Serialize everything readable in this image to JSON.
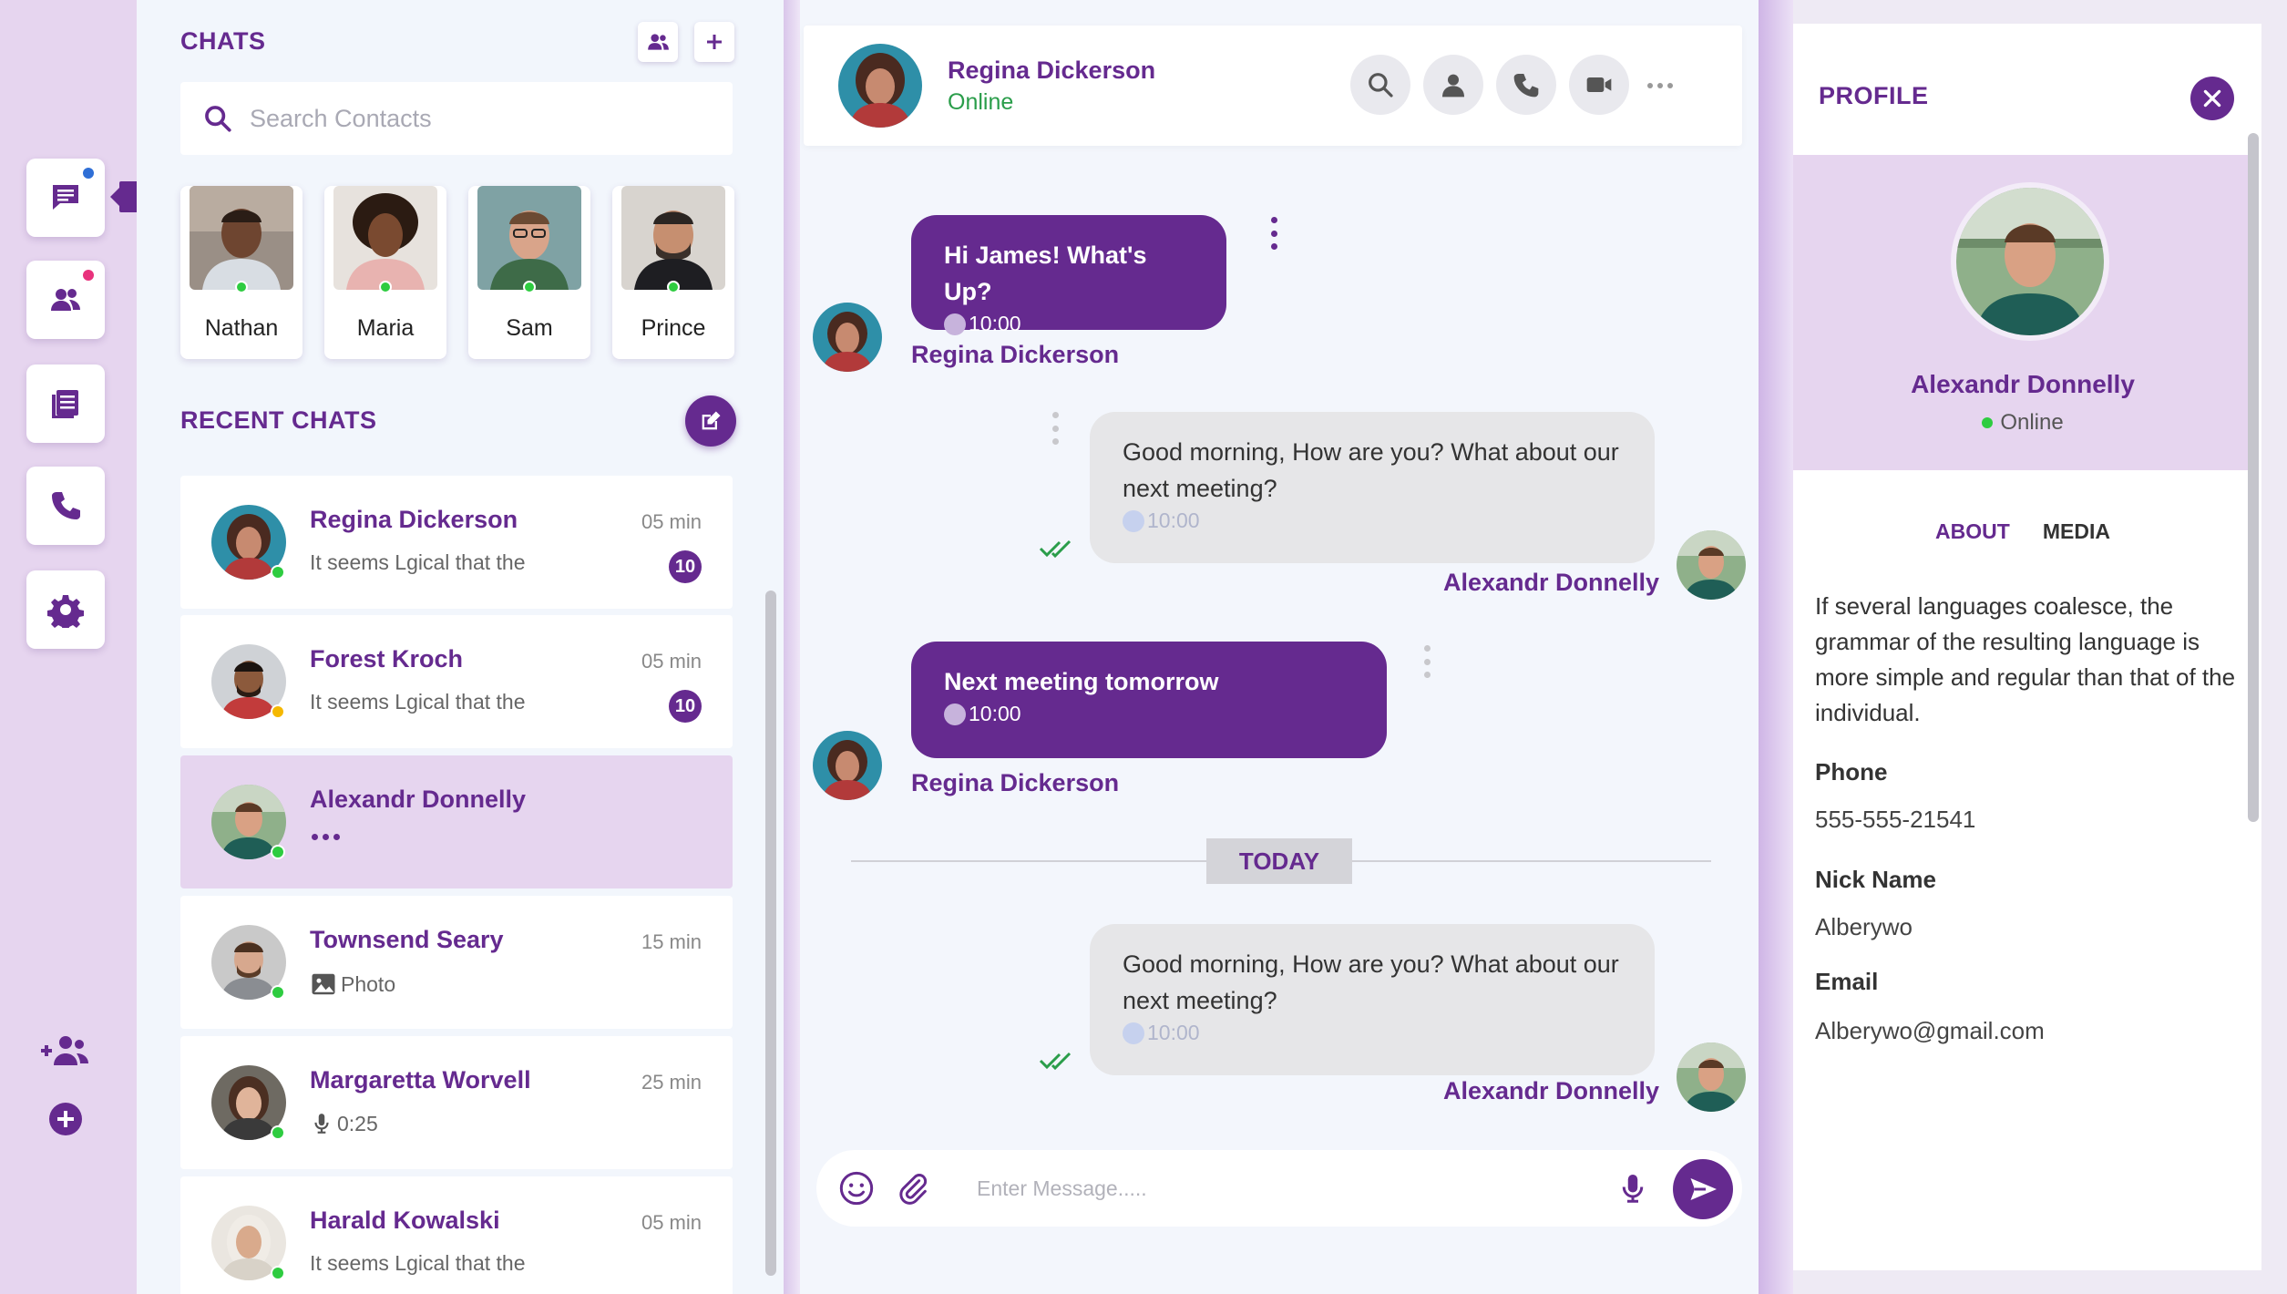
{
  "rail": {
    "tooltip": "Chat",
    "items": [
      {
        "name": "chat",
        "icon": "chat-icon",
        "dot": "#2f6fd6"
      },
      {
        "name": "contacts",
        "icon": "contacts-icon",
        "dot": "#e8327c"
      },
      {
        "name": "documents",
        "icon": "documents-icon"
      },
      {
        "name": "calls",
        "icon": "phone-icon"
      },
      {
        "name": "settings",
        "icon": "gear-icon"
      }
    ],
    "bottom": [
      "add-group-icon",
      "add-circle-icon"
    ]
  },
  "chats": {
    "title": "CHATS",
    "search_placeholder": "Search Contacts",
    "stories": [
      "Nathan",
      "Maria",
      "Sam",
      "Prince"
    ]
  },
  "recent": {
    "title": "RECENT CHATS",
    "items": [
      {
        "name": "Regina Dickerson",
        "message": "It seems Lgical that the",
        "time": "05 min",
        "badge": "10",
        "status": "#2ecc40"
      },
      {
        "name": "Forest Kroch",
        "message": "It seems Lgical that the",
        "time": "05 min",
        "badge": "10",
        "status": "#f5b800"
      },
      {
        "name": "Alexandr Donnelly",
        "message": "",
        "time": "",
        "badge": "",
        "status": "#2ecc40",
        "typing": true
      },
      {
        "name": "Townsend Seary",
        "message": "Photo",
        "time": "15 min",
        "badge": "",
        "status": "#2ecc40",
        "icon": "photo-icon"
      },
      {
        "name": "Margaretta Worvell",
        "message": "0:25",
        "time": "25 min",
        "badge": "",
        "status": "#2ecc40",
        "icon": "microphone-icon"
      },
      {
        "name": "Harald Kowalski",
        "message": "It seems Lgical that the",
        "time": "05 min",
        "badge": "",
        "status": "#2ecc40"
      }
    ]
  },
  "conversation": {
    "contact_name": "Regina Dickerson",
    "contact_status": "Online",
    "messages": [
      {
        "direction": "in",
        "text": "Hi James! What's Up?",
        "time": "10:00",
        "sender": "Regina Dickerson"
      },
      {
        "direction": "out",
        "text": "Good morning, How are you? What about our next meeting?",
        "time": "10:00",
        "sender": "Alexandr Donnelly"
      },
      {
        "direction": "in",
        "text": "Next meeting tomorrow",
        "time": "10:00",
        "sender": "Regina Dickerson"
      },
      {
        "direction": "out",
        "text": "Good morning, How are you? What about our next meeting?",
        "time": "10:00",
        "sender": "Alexandr Donnelly"
      }
    ],
    "separator": "TODAY",
    "composer_placeholder": "Enter Message....."
  },
  "profile": {
    "title": "PROFILE",
    "name": "Alexandr Donnelly",
    "status": "Online",
    "tabs": [
      "ABOUT",
      "MEDIA"
    ],
    "about": "If several languages coalesce, the grammar of the resulting language is more simple and regular than that of the individual.",
    "phone_label": "Phone",
    "phone": "555-555-21541",
    "nick_label": "Nick Name",
    "nick": "Alberywo",
    "email_label": "Email",
    "email": "Alberywo@gmail.com"
  },
  "colors": {
    "accent": "#652a8f",
    "rail_bg": "#e6d5ef",
    "online": "#2ecc40",
    "away": "#f5b800"
  }
}
